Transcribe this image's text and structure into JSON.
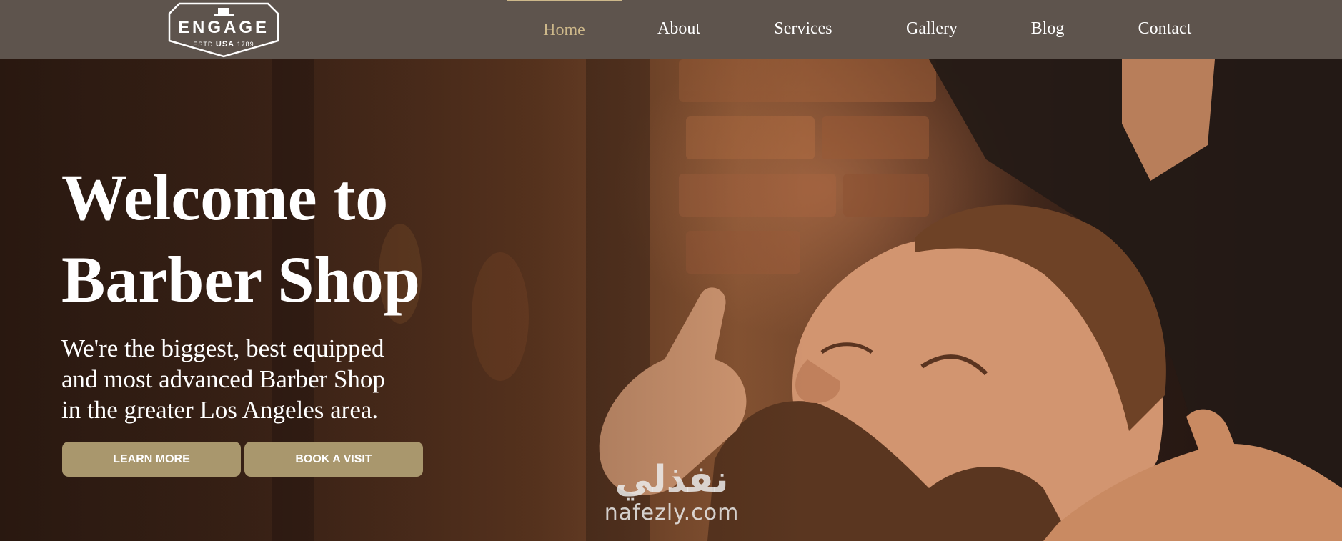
{
  "logo": {
    "title": "ENGAGE",
    "sub_left": "ESTD",
    "sub_mid": "USA",
    "sub_right": "1789"
  },
  "nav": {
    "items": [
      {
        "label": "Home",
        "active": true
      },
      {
        "label": "About",
        "active": false
      },
      {
        "label": "Services",
        "active": false
      },
      {
        "label": "Gallery",
        "active": false
      },
      {
        "label": "Blog",
        "active": false
      },
      {
        "label": "Contact",
        "active": false
      }
    ]
  },
  "hero": {
    "title_line1": "Welcome to",
    "title_line2": "Barber Shop",
    "subtitle_line1": "We're the biggest, best equipped",
    "subtitle_line2": "and most advanced Barber Shop",
    "subtitle_line3": "in the greater Los Angeles area.",
    "learn_more_label": "LEARN MORE",
    "book_visit_label": "BOOK A VISIT"
  },
  "watermark": {
    "arabic": "نفذلي",
    "latin": "nafezly.com"
  },
  "colors": {
    "navbar_bg": "#5e544d",
    "accent": "#cdb88a",
    "button_bg": "#a9976d"
  }
}
